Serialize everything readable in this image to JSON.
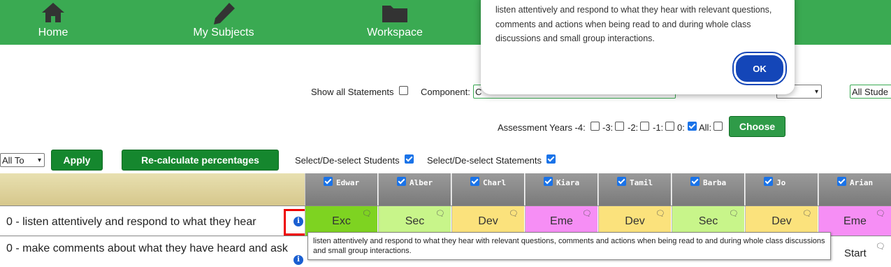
{
  "nav": {
    "home": "Home",
    "subjects": "My Subjects",
    "workspace": "Workspace"
  },
  "modal": {
    "text": "listen attentively and respond to what they hear with relevant questions, comments and actions when being read to and during whole class discussions and small group interactions.",
    "ok": "OK"
  },
  "filters": {
    "show_all_label": "Show all Statements",
    "component_label": "Component:",
    "component_value": "C",
    "students_value": "All Stude",
    "years_label": "Assessment Years -4:",
    "y3": "-3:",
    "y2": "-2:",
    "y1": "-1:",
    "y0": "0:",
    "all": "All:",
    "choose": "Choose"
  },
  "toolbar": {
    "select_value": "All To",
    "apply": "Apply",
    "recalc": "Re-calculate percentages",
    "select_students": "Select/De-select Students",
    "select_statements": "Select/De-select Statements"
  },
  "students": [
    "Edwar",
    "Alber",
    "Charl",
    "Kiara",
    "Tamil",
    "Barba",
    "Jo",
    "Arian"
  ],
  "rows": [
    {
      "statement": "0 - listen attentively and respond to what they hear",
      "values": [
        "Exc",
        "Sec",
        "Dev",
        "Eme",
        "Dev",
        "Sec",
        "Dev",
        "Eme"
      ]
    },
    {
      "statement": "0 - make comments about what they have heard and ask",
      "values": [
        "",
        "",
        "",
        "",
        "",
        "",
        "",
        "Start"
      ]
    }
  ],
  "colors": {
    "Exc": "#7ed321",
    "Sec": "#c8f58a",
    "Dev": "#fbe27c",
    "Eme": "#f68ef5"
  },
  "tooltip": "listen attentively and respond to what they hear with relevant questions, comments and actions when being read to and during whole class discussions and small group interactions."
}
